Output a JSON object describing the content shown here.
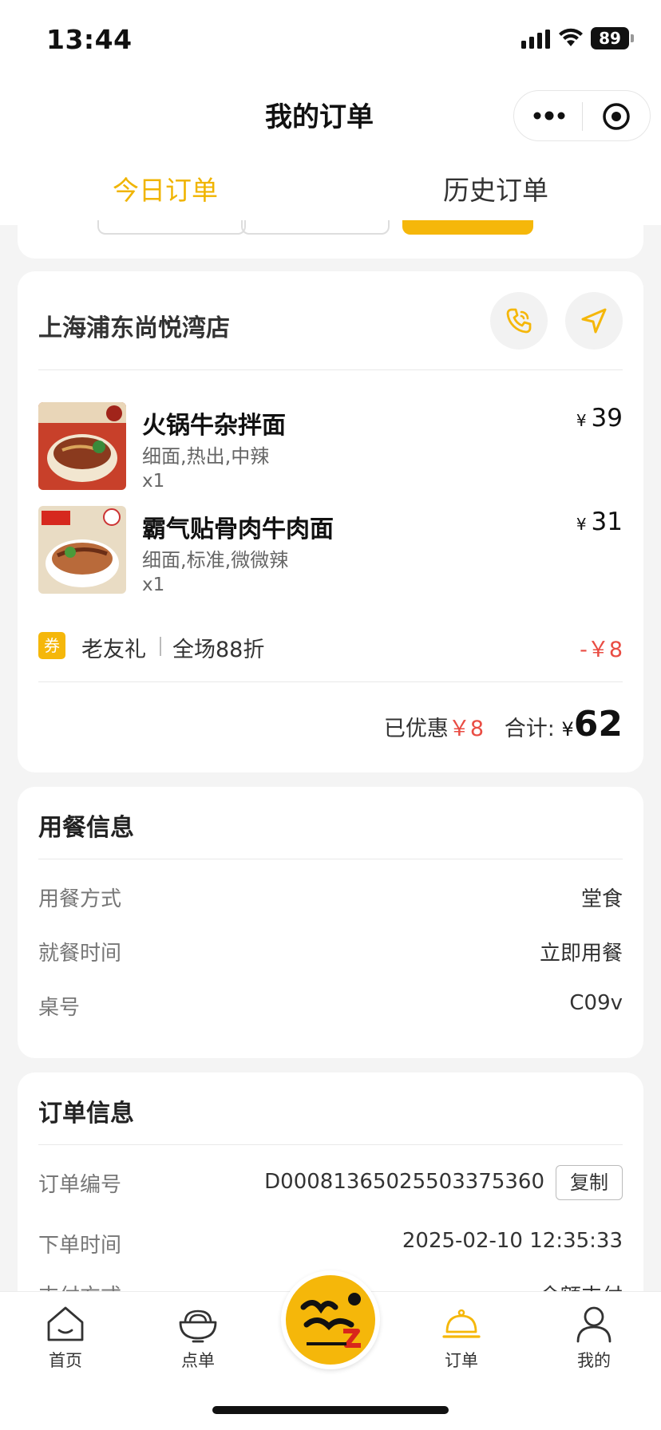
{
  "status_bar": {
    "time": "13:44",
    "battery": "89"
  },
  "navbar": {
    "title": "我的订单"
  },
  "tabs": [
    {
      "label": "今日订单",
      "active": true
    },
    {
      "label": "历史订单",
      "active": false
    }
  ],
  "order": {
    "store_name": "上海浦东尚悦湾店",
    "items": [
      {
        "name": "火锅牛杂拌面",
        "options": "细面,热出,中辣",
        "qty": "x1",
        "currency": "¥",
        "price": "39"
      },
      {
        "name": "霸气贴骨肉牛肉面",
        "options": "细面,标准,微微辣",
        "qty": "x1",
        "currency": "¥",
        "price": "31"
      }
    ],
    "coupon": {
      "badge": "券",
      "name": "老友礼",
      "desc": "全场88折",
      "amount": "-￥8"
    },
    "totals": {
      "discount_label": "已优惠",
      "discount_value": "￥8",
      "total_label": "合计:",
      "currency": "¥",
      "total_value": "62"
    }
  },
  "meal_info": {
    "title": "用餐信息",
    "rows": [
      {
        "label": "用餐方式",
        "value": "堂食"
      },
      {
        "label": "就餐时间",
        "value": "立即用餐"
      },
      {
        "label": "桌号",
        "value": "C09v"
      }
    ]
  },
  "order_info": {
    "title": "订单信息",
    "order_no_label": "订单编号",
    "order_no": "D00081365025503375360",
    "copy_label": "复制",
    "time_label": "下单时间",
    "time_value": "2025-02-10 12:35:33",
    "pay_label": "支付方式",
    "pay_value": "余额支付"
  },
  "tabbar": [
    {
      "label": "首页",
      "icon": "home-icon"
    },
    {
      "label": "点单",
      "icon": "bowl-icon"
    },
    {
      "label": "订单",
      "icon": "cloche-icon",
      "active": true
    },
    {
      "label": "我的",
      "icon": "user-icon"
    }
  ],
  "colors": {
    "accent": "#f5b70a",
    "discount": "#e94c43"
  }
}
